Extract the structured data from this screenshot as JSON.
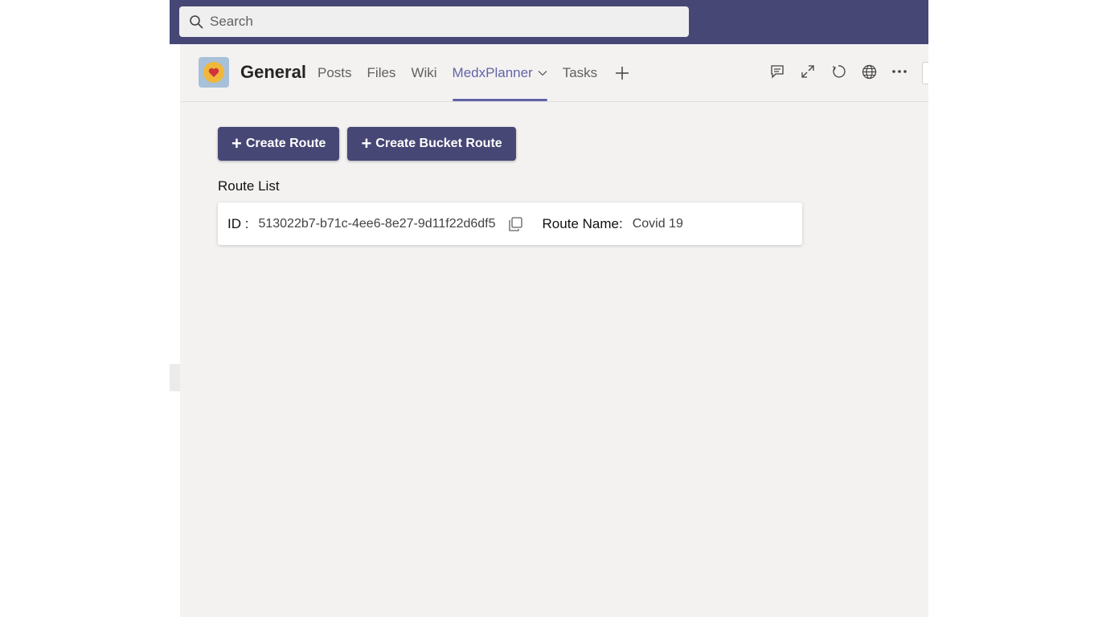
{
  "search": {
    "placeholder": "Search"
  },
  "channel": {
    "name": "General"
  },
  "tabs": [
    {
      "label": "Posts",
      "active": false
    },
    {
      "label": "Files",
      "active": false
    },
    {
      "label": "Wiki",
      "active": false
    },
    {
      "label": "MedxPlanner",
      "active": true,
      "has_dropdown": true
    },
    {
      "label": "Tasks",
      "active": false
    }
  ],
  "header_actions": [
    "conversation-icon",
    "expand-icon",
    "reload-icon",
    "globe-icon",
    "more-options-icon"
  ],
  "actions": {
    "create_route_label": "Create Route",
    "create_bucket_route_label": "Create Bucket Route"
  },
  "route_list": {
    "title": "Route List",
    "id_label": "ID :",
    "name_label": "Route Name:",
    "items": [
      {
        "id": "513022b7-b71c-4ee6-8e27-9d11f22d6df5",
        "name": "Covid 19"
      }
    ]
  },
  "colors": {
    "topbar": "#464775",
    "accent": "#6264a7",
    "button": "#464775",
    "background": "#f3f2f1"
  }
}
